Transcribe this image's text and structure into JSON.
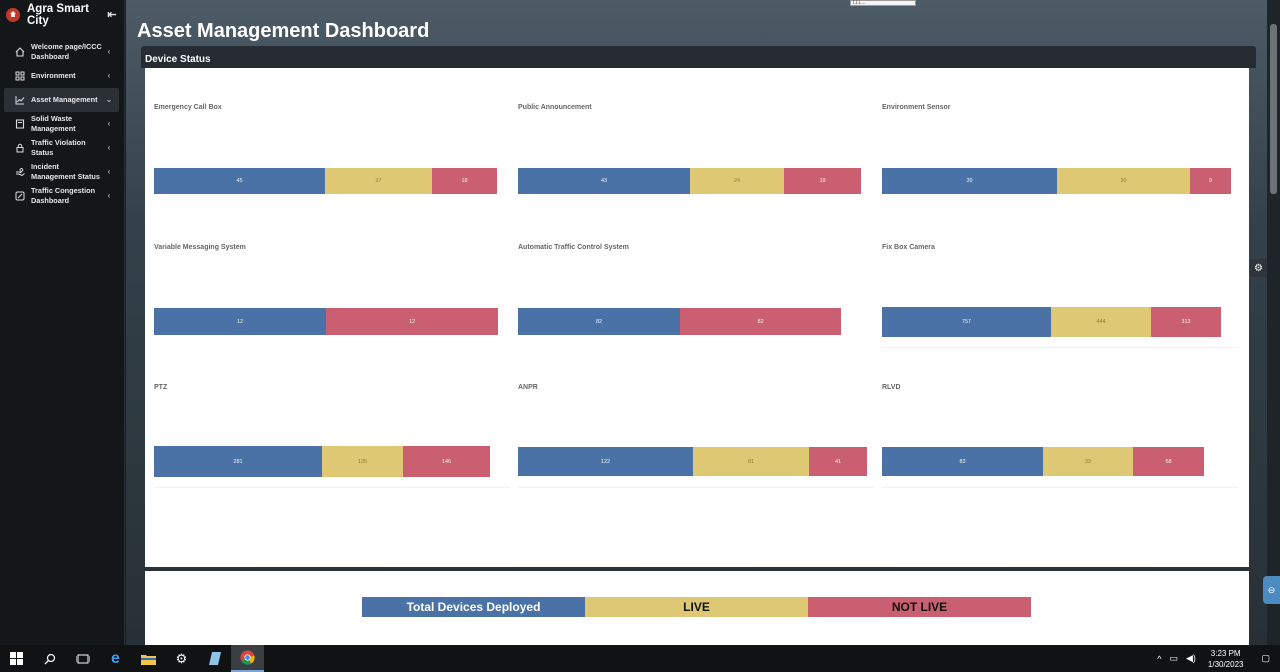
{
  "app": {
    "name": "Agra Smart City"
  },
  "sidebar": {
    "items": [
      {
        "label": "Welcome page/ICCC Dashboard",
        "icon": "home-icon",
        "active": false
      },
      {
        "label": "Environment",
        "icon": "grid-icon",
        "active": false
      },
      {
        "label": "Asset Management",
        "icon": "chart-line-icon",
        "active": true
      },
      {
        "label": "Solid Waste Management",
        "icon": "bin-icon",
        "active": false
      },
      {
        "label": "Traffic Violation Status",
        "icon": "lock-icon",
        "active": false
      },
      {
        "label": "Incident Management Status",
        "icon": "hand-icon",
        "active": false
      },
      {
        "label": "Traffic Congestion Dashboard",
        "icon": "edit-square-icon",
        "active": false
      }
    ]
  },
  "page": {
    "title": "Asset Management Dashboard"
  },
  "card": {
    "title": "Device Status"
  },
  "top_input": {
    "value": "LLL..."
  },
  "colors": {
    "deployed": "#4a72a6",
    "live": "#dfc873",
    "not_live": "#c95f70"
  },
  "panels": [
    {
      "title": "Emergency Call Box",
      "deployed": "45",
      "live": "27",
      "not_live": "18"
    },
    {
      "title": "Public Announcement",
      "deployed": "43",
      "live": "24",
      "not_live": "19"
    },
    {
      "title": "Environment Sensor",
      "deployed": "39",
      "live": "30",
      "not_live": "9"
    },
    {
      "title": "Variable Messaging System",
      "deployed": "12",
      "live": "",
      "not_live": "12"
    },
    {
      "title": "Automatic Traffic Control System",
      "deployed": "82",
      "live": "",
      "not_live": "82"
    },
    {
      "title": "Fix Box Camera",
      "deployed": "757",
      "live": "444",
      "not_live": "313"
    },
    {
      "title": "PTZ",
      "deployed": "281",
      "live": "135",
      "not_live": "146"
    },
    {
      "title": "ANPR",
      "deployed": "122",
      "live": "81",
      "not_live": "41"
    },
    {
      "title": "RLVD",
      "deployed": "83",
      "live": "33",
      "not_live": "58"
    }
  ],
  "legend": {
    "deployed": "Total Devices Deployed",
    "live": "LIVE",
    "not_live": "NOT LIVE"
  },
  "taskbar": {
    "time": "3:23 PM",
    "date": "1/30/2023"
  }
}
